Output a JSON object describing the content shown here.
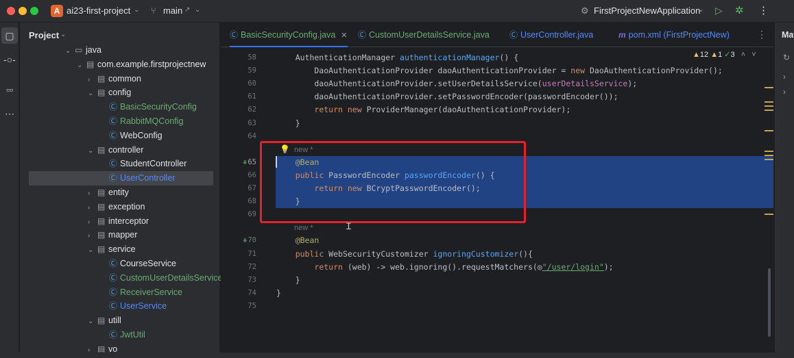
{
  "titlebar": {
    "project_badge": "A",
    "project_name": "ai23-first-project",
    "branch": "main",
    "branch_arrow": "↗",
    "run_config": "FirstProjectNewApplication"
  },
  "project_panel": {
    "title": "Project",
    "tree": [
      {
        "label": "java",
        "type": "folder",
        "open": true,
        "indent": 0
      },
      {
        "label": "com.example.firstprojectnew",
        "type": "package",
        "open": true,
        "indent": 1
      },
      {
        "label": "common",
        "type": "package",
        "open": false,
        "indent": 2
      },
      {
        "label": "config",
        "type": "package",
        "open": true,
        "indent": 2
      },
      {
        "label": "BasicSecurityConfig",
        "type": "class",
        "color": "green",
        "indent": 3
      },
      {
        "label": "RabbitMQConfig",
        "type": "class",
        "color": "green",
        "indent": 3
      },
      {
        "label": "WebConfig",
        "type": "class",
        "color": "default",
        "indent": 3
      },
      {
        "label": "controller",
        "type": "package",
        "open": true,
        "indent": 2
      },
      {
        "label": "StudentController",
        "type": "class",
        "color": "default",
        "indent": 3
      },
      {
        "label": "UserController",
        "type": "class",
        "color": "blue",
        "indent": 3,
        "selected": true
      },
      {
        "label": "entity",
        "type": "package",
        "open": false,
        "indent": 2
      },
      {
        "label": "exception",
        "type": "package",
        "open": false,
        "indent": 2
      },
      {
        "label": "interceptor",
        "type": "package",
        "open": false,
        "indent": 2
      },
      {
        "label": "mapper",
        "type": "package",
        "open": false,
        "indent": 2
      },
      {
        "label": "service",
        "type": "package",
        "open": true,
        "indent": 2
      },
      {
        "label": "CourseService",
        "type": "class",
        "color": "default",
        "indent": 3
      },
      {
        "label": "CustomUserDetailsService",
        "type": "class",
        "color": "green",
        "indent": 3
      },
      {
        "label": "ReceiverService",
        "type": "class",
        "color": "green",
        "indent": 3
      },
      {
        "label": "UserService",
        "type": "class",
        "color": "blue",
        "indent": 3
      },
      {
        "label": "utill",
        "type": "package",
        "open": true,
        "indent": 2
      },
      {
        "label": "JwtUtil",
        "type": "class",
        "color": "green",
        "indent": 3
      },
      {
        "label": "vo",
        "type": "package",
        "open": false,
        "indent": 2
      }
    ]
  },
  "tabs": [
    {
      "label": "BasicSecurityConfig.java",
      "color": "green",
      "active": true,
      "closable": true,
      "icon": "class-icon"
    },
    {
      "label": "CustomUserDetailsService.java",
      "color": "green",
      "active": false,
      "icon": "class-icon"
    },
    {
      "label": "UserController.java",
      "color": "blue",
      "active": false,
      "icon": "class-icon"
    },
    {
      "label": "pom.xml (FirstProjectNew)",
      "color": "blue",
      "active": false,
      "icon": "maven-icon"
    }
  ],
  "inspections": {
    "warnings": "12",
    "weak_warnings": "1",
    "ok": "3"
  },
  "editor": {
    "lines": [
      {
        "n": "58",
        "tokens": [
          [
            "",
            "    AuthenticationManager "
          ],
          [
            "fn",
            "authenticationManager"
          ],
          [
            "",
            "() {"
          ]
        ]
      },
      {
        "n": "59",
        "tokens": [
          [
            "",
            "        DaoAuthenticationProvider daoAuthenticationProvider = "
          ],
          [
            "kw",
            "new"
          ],
          [
            "",
            " DaoAuthenticationProvider();"
          ]
        ]
      },
      {
        "n": "60",
        "tokens": [
          [
            "",
            "        daoAuthenticationProvider.setUserDetailsService("
          ],
          [
            "fld",
            "userDetailsService"
          ],
          [
            "",
            ");"
          ]
        ]
      },
      {
        "n": "61",
        "tokens": [
          [
            "",
            "        daoAuthenticationProvider.setPasswordEncoder(passwordEncoder());"
          ]
        ]
      },
      {
        "n": "62",
        "tokens": [
          [
            "",
            "        "
          ],
          [
            "kw",
            "return new"
          ],
          [
            "",
            " ProviderManager(daoAuthenticationProvider);"
          ]
        ]
      },
      {
        "n": "63",
        "tokens": [
          [
            "",
            "    }"
          ]
        ]
      },
      {
        "n": "64",
        "tokens": []
      },
      {
        "n": "",
        "hint": "new *",
        "bulb": true,
        "tokens": []
      },
      {
        "n": "65",
        "bean": true,
        "current": true,
        "selected": true,
        "tokens": [
          [
            "ann",
            "    @Bean"
          ]
        ]
      },
      {
        "n": "66",
        "selected": true,
        "tokens": [
          [
            "",
            "    "
          ],
          [
            "kw",
            "public"
          ],
          [
            "",
            " PasswordEncoder "
          ],
          [
            "fn",
            "passwordEncoder"
          ],
          [
            "",
            "() {"
          ]
        ]
      },
      {
        "n": "67",
        "selected": true,
        "tokens": [
          [
            "",
            "        "
          ],
          [
            "kw",
            "return new"
          ],
          [
            "",
            " BCryptPasswordEncoder();"
          ]
        ]
      },
      {
        "n": "68",
        "selected": true,
        "tokens": [
          [
            "",
            "    }"
          ]
        ]
      },
      {
        "n": "69",
        "tokens": []
      },
      {
        "n": "",
        "hint": "new *",
        "tokens": []
      },
      {
        "n": "70",
        "bean": true,
        "tokens": [
          [
            "ann",
            "    @Bean"
          ]
        ]
      },
      {
        "n": "71",
        "tokens": [
          [
            "",
            "    "
          ],
          [
            "kw",
            "public"
          ],
          [
            "",
            " WebSecurityCustomizer "
          ],
          [
            "fn",
            "ignoringCustomizer"
          ],
          [
            "",
            "(){"
          ]
        ]
      },
      {
        "n": "72",
        "tokens": [
          [
            "",
            "        "
          ],
          [
            "kw",
            "return"
          ],
          [
            "",
            " (web) -> web.ignoring().requestMatchers(◎"
          ],
          [
            "str",
            "\"/user/login\""
          ],
          [
            "",
            ");"
          ]
        ]
      },
      {
        "n": "73",
        "tokens": [
          [
            "",
            "    }"
          ]
        ]
      },
      {
        "n": "74",
        "tokens": [
          [
            "",
            "}"
          ]
        ]
      },
      {
        "n": "75",
        "tokens": []
      }
    ]
  },
  "right_panel": {
    "title": "Mav"
  }
}
